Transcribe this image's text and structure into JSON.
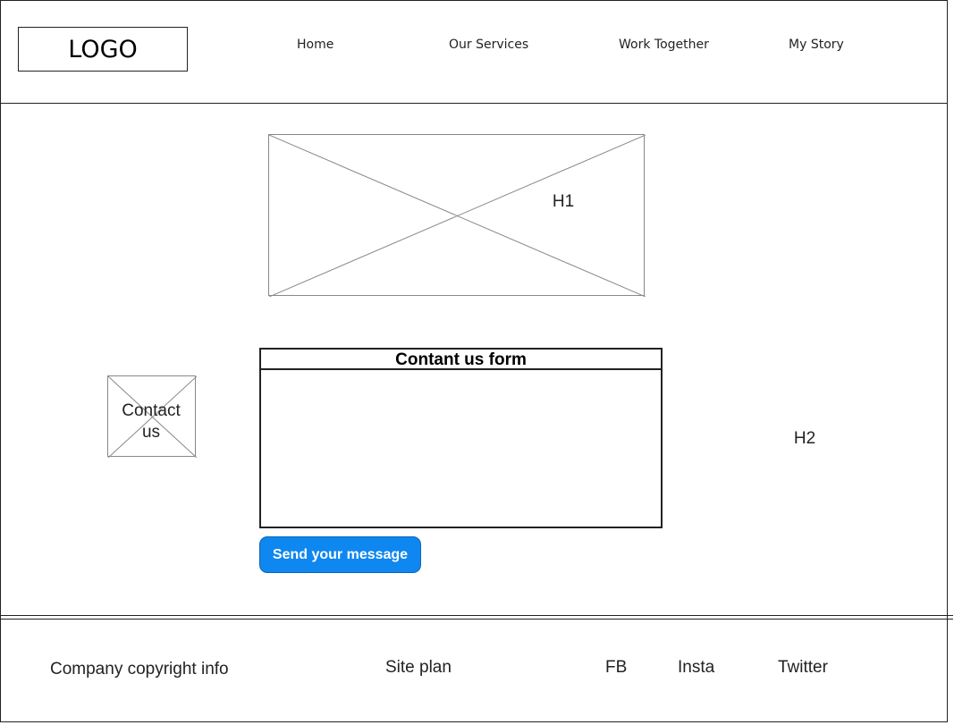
{
  "header": {
    "logo": "LOGO",
    "nav": [
      {
        "label": "Home"
      },
      {
        "label": "Our Services"
      },
      {
        "label": "Work Together"
      },
      {
        "label": "My Story"
      }
    ]
  },
  "hero": {
    "heading": "H1",
    "image_icon": "image-placeholder-icon"
  },
  "contact": {
    "label": "Contact us",
    "image_icon": "image-placeholder-icon",
    "form_title": "Contant us form",
    "form_value": "",
    "send_label": "Send your message",
    "send_color": "#0f87f0",
    "side_heading": "H2"
  },
  "footer": {
    "copyright": "Company copyright info",
    "site_plan": "Site plan",
    "social": [
      {
        "label": "FB"
      },
      {
        "label": "Insta"
      },
      {
        "label": "Twitter"
      }
    ]
  }
}
